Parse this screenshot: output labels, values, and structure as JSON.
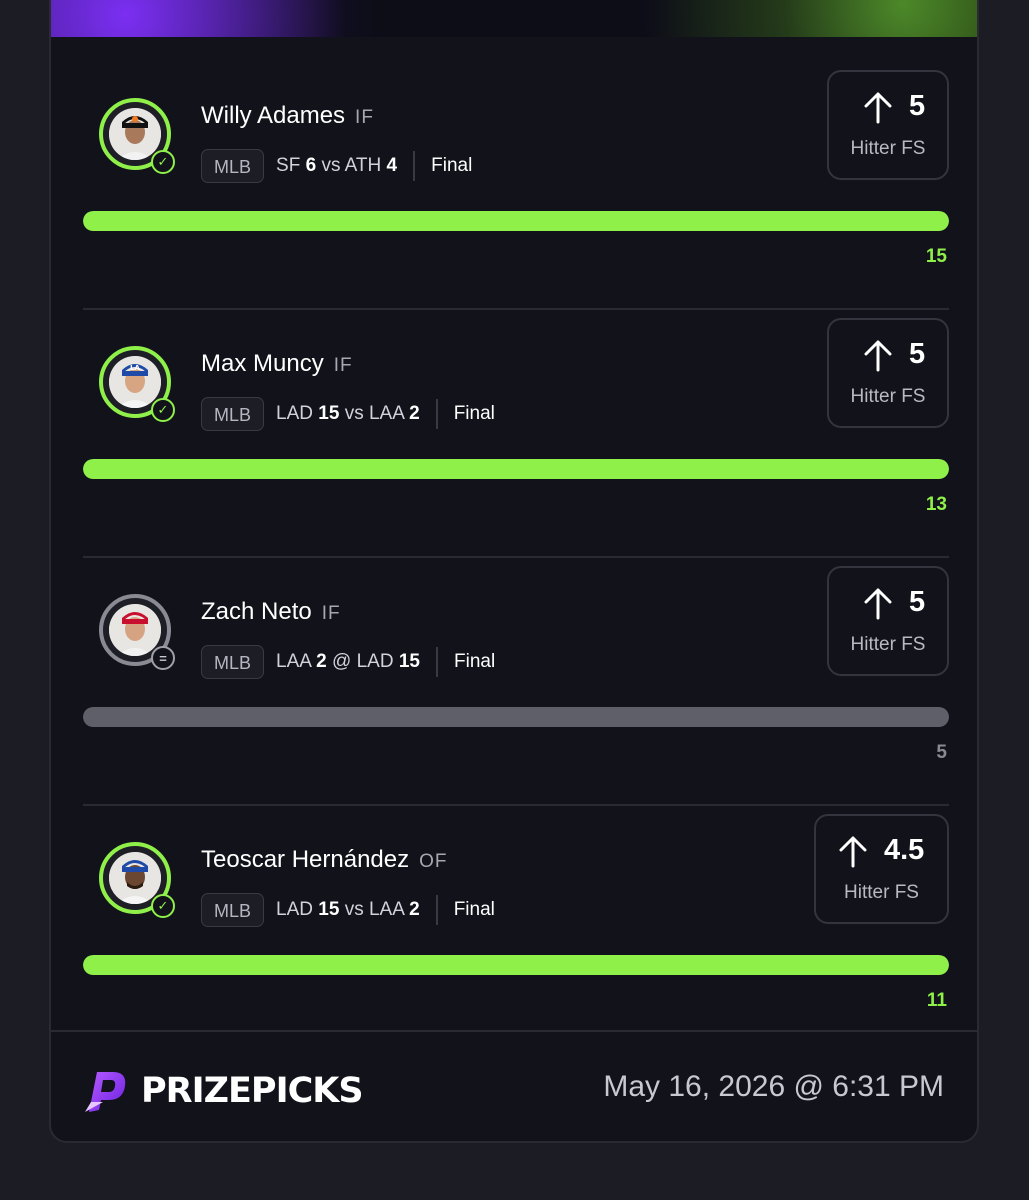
{
  "picks": [
    {
      "name": "Willy Adames",
      "position": "IF",
      "league": "MLB",
      "team_a": "SF",
      "score_a": "6",
      "connector": "vs",
      "team_b": "ATH",
      "score_b": "4",
      "status": "Final",
      "line": "5",
      "stat": "Hitter FS",
      "direction": "up-arrow-icon",
      "result": "15",
      "outcome": "win",
      "progress": 1.0
    },
    {
      "name": "Max Muncy",
      "position": "IF",
      "league": "MLB",
      "team_a": "LAD",
      "score_a": "15",
      "connector": "vs",
      "team_b": "LAA",
      "score_b": "2",
      "status": "Final",
      "line": "5",
      "stat": "Hitter FS",
      "direction": "up-arrow-icon",
      "result": "13",
      "outcome": "win",
      "progress": 1.0
    },
    {
      "name": "Zach Neto",
      "position": "IF",
      "league": "MLB",
      "team_a": "LAA",
      "score_a": "2",
      "connector": "@",
      "team_b": "LAD",
      "score_b": "15",
      "status": "Final",
      "line": "5",
      "stat": "Hitter FS",
      "direction": "up-arrow-icon",
      "result": "5",
      "outcome": "push",
      "progress": 1.0
    },
    {
      "name": "Teoscar Hernández",
      "position": "OF",
      "league": "MLB",
      "team_a": "LAD",
      "score_a": "15",
      "connector": "vs",
      "team_b": "LAA",
      "score_b": "2",
      "status": "Final",
      "line": "4.5",
      "stat": "Hitter FS",
      "direction": "up-arrow-icon",
      "result": "11",
      "outcome": "win",
      "progress": 1.0
    }
  ],
  "footer": {
    "brand": "PRIZEPICKS",
    "timestamp": "May 16, 2026 @ 6:31 PM"
  },
  "colors": {
    "win": "#8ff04a",
    "push": "#5f5f69",
    "brand_purple": "#8b2ff5"
  }
}
